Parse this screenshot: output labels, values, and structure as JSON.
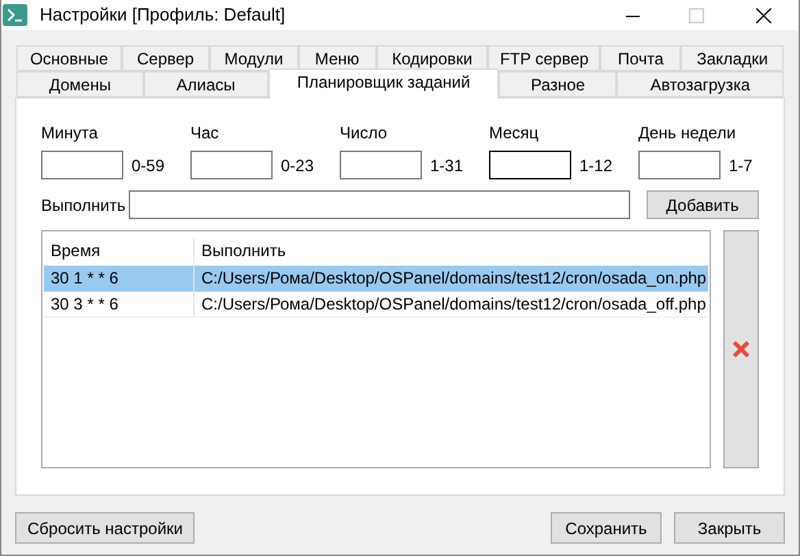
{
  "window": {
    "title": "Настройки [Профиль: Default]"
  },
  "tab_rows": [
    {
      "tabs": [
        {
          "label": "Основные",
          "selected": false
        },
        {
          "label": "Сервер",
          "selected": false
        },
        {
          "label": "Модули",
          "selected": false
        },
        {
          "label": "Меню",
          "selected": false
        },
        {
          "label": "Кодировки",
          "selected": false
        },
        {
          "label": "FTP сервер",
          "selected": false
        },
        {
          "label": "Почта",
          "selected": false
        },
        {
          "label": "Закладки",
          "selected": false
        }
      ]
    },
    {
      "tabs": [
        {
          "label": "Домены",
          "selected": false
        },
        {
          "label": "Алиасы",
          "selected": false
        },
        {
          "label": "Планировщик заданий",
          "selected": true
        },
        {
          "label": "Разное",
          "selected": false
        },
        {
          "label": "Автозагрузка",
          "selected": false
        }
      ]
    }
  ],
  "schedule_fields": [
    {
      "label": "Минута",
      "range": "0-59",
      "focused": false
    },
    {
      "label": "Час",
      "range": "0-23",
      "focused": false
    },
    {
      "label": "Число",
      "range": "1-31",
      "focused": false
    },
    {
      "label": "Месяц",
      "range": "1-12",
      "focused": true
    },
    {
      "label": "День недели",
      "range": "1-7",
      "focused": false
    }
  ],
  "command": {
    "label": "Выполнить",
    "add_button": "Добавить"
  },
  "table": {
    "columns": [
      "Время",
      "Выполнить"
    ],
    "rows": [
      {
        "cells": [
          "30 1 * * 6",
          "C:/Users/Рома/Desktop/OSPanel/domains/test12/cron/osada_on.php"
        ],
        "selected": true
      },
      {
        "cells": [
          "30 3 * * 6",
          "C:/Users/Рома/Desktop/OSPanel/domains/test12/cron/osada_off.php"
        ],
        "selected": false
      }
    ]
  },
  "buttons": {
    "reset": "Сбросить настройки",
    "save": "Сохранить",
    "close": "Закрыть"
  }
}
